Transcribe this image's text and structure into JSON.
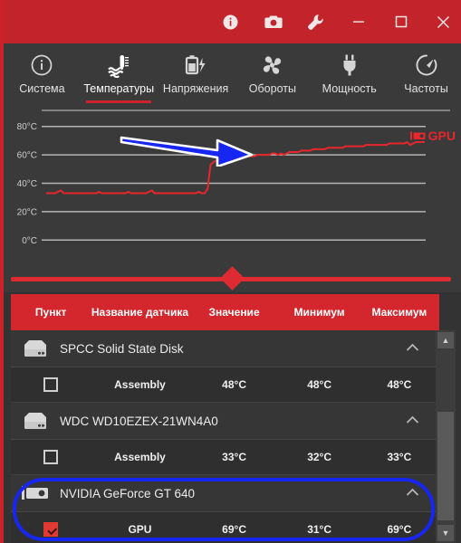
{
  "window": {
    "titlebar_color": "#c3242b",
    "buttons": [
      {
        "name": "info-button",
        "icon": "info-icon",
        "label": "i"
      },
      {
        "name": "screenshot-button",
        "icon": "camera-icon",
        "label": ""
      },
      {
        "name": "settings-button",
        "icon": "wrench-icon",
        "label": ""
      },
      {
        "name": "minimize-button",
        "icon": "minimize-icon",
        "label": ""
      },
      {
        "name": "maximize-button",
        "icon": "maximize-icon",
        "label": ""
      },
      {
        "name": "close-button",
        "icon": "close-icon",
        "label": ""
      }
    ]
  },
  "tabs": [
    {
      "label": "Система",
      "icon": "info-circle-icon",
      "active": false
    },
    {
      "label": "Температуры",
      "icon": "thermometer-icon",
      "active": true
    },
    {
      "label": "Напряжения",
      "icon": "battery-bolt-icon",
      "active": false
    },
    {
      "label": "Обороты",
      "icon": "fan-icon",
      "active": false
    },
    {
      "label": "Мощность",
      "icon": "power-plug-icon",
      "active": false
    },
    {
      "label": "Частоты",
      "icon": "gauge-icon",
      "active": false
    }
  ],
  "chart_data": {
    "type": "line",
    "title": "",
    "xlabel": "",
    "ylabel": "",
    "ylim": [
      -10,
      90
    ],
    "yticks": [
      "0°C",
      "20°C",
      "40°C",
      "60°C",
      "80°C"
    ],
    "ytick_values": [
      0,
      20,
      40,
      60,
      80
    ],
    "grid": true,
    "legend_position": "right",
    "series": [
      {
        "name": "GPU",
        "color": "#e8262c",
        "values": [
          33,
          33,
          33,
          33,
          34,
          35,
          33,
          33,
          33,
          33,
          33,
          33,
          33,
          33,
          33,
          33,
          33,
          33,
          34,
          33,
          33,
          33,
          33,
          33,
          33,
          33,
          33,
          33,
          34,
          33,
          33,
          33,
          33,
          33,
          33,
          34,
          35,
          33,
          33,
          33,
          33,
          33,
          33,
          33,
          33,
          33,
          33,
          33,
          33,
          33,
          33,
          33,
          34,
          33,
          33,
          36,
          53,
          55,
          56,
          56,
          57,
          57,
          57,
          58,
          58,
          58,
          58,
          59,
          59,
          59,
          59,
          59,
          60,
          60,
          60,
          60,
          60,
          61,
          61,
          60,
          61,
          60,
          61,
          62,
          62,
          62,
          62,
          63,
          63,
          63,
          63,
          64,
          64,
          64,
          64,
          64,
          65,
          65,
          65,
          65,
          65,
          65,
          66,
          66,
          66,
          66,
          66,
          66,
          66,
          67,
          67,
          67,
          67,
          67,
          67,
          67,
          67,
          68,
          68,
          68,
          68,
          68,
          68,
          69,
          67,
          68,
          69,
          69,
          69,
          69
        ]
      }
    ]
  },
  "legend": {
    "label": "GPU",
    "icon": "gpu-card-icon",
    "color": "#e8262c"
  },
  "slider": {
    "name": "timeline-slider",
    "value_percent": 50
  },
  "table": {
    "columns": [
      "Пункт",
      "Название датчика",
      "Значение",
      "Минимум",
      "Максимум"
    ],
    "groups": [
      {
        "name": "SPCC Solid State Disk",
        "icon": "hdd-icon",
        "expanded": true,
        "rows": [
          {
            "checked": false,
            "sensor": "Assembly",
            "value": "48°C",
            "min": "48°C",
            "max": "48°C"
          }
        ]
      },
      {
        "name": "WDC WD10EZEX-21WN4A0",
        "icon": "hdd-icon",
        "expanded": true,
        "rows": [
          {
            "checked": false,
            "sensor": "Assembly",
            "value": "33°C",
            "min": "32°C",
            "max": "33°C"
          }
        ]
      },
      {
        "name": "NVIDIA GeForce GT 640",
        "icon": "gpu-card-icon",
        "expanded": true,
        "highlighted": true,
        "rows": [
          {
            "checked": true,
            "sensor": "GPU",
            "value": "69°C",
            "min": "31°C",
            "max": "69°C"
          }
        ]
      }
    ]
  },
  "scrollbar": {
    "up_arrow": "▲",
    "down_arrow": "▼"
  },
  "annotations": {
    "arrow_color": "#1726f0",
    "ellipse_color": "#1726f0"
  },
  "colors": {
    "accent_red": "#cc2229",
    "header_red": "#d3272d",
    "panel_bg": "#3a3a3a",
    "row_bg": "#2f2f2f"
  }
}
